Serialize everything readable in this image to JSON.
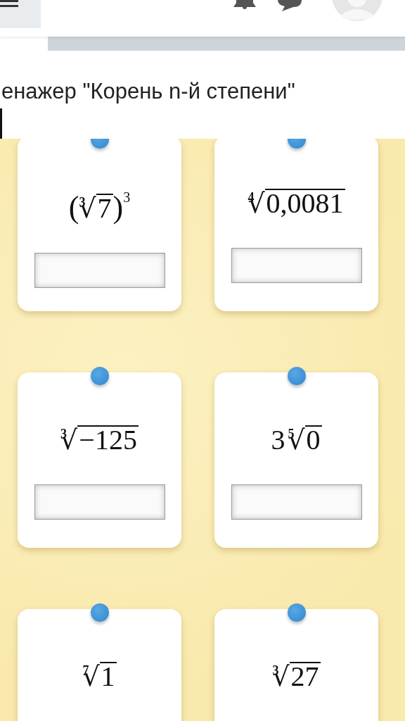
{
  "header": {
    "title": "енажер \"Корень n-й степени\""
  },
  "cards": [
    {
      "expression": {
        "open": "(",
        "index": "3",
        "sign": "√",
        "radicand": "7",
        "close": ")",
        "power": "3"
      },
      "kind": "full"
    },
    {
      "expression": {
        "index": "4",
        "sign": "√",
        "radicand": "0,0081"
      },
      "kind": "full"
    },
    {
      "expression": {
        "index": "3",
        "sign": "√",
        "radicand": "−125"
      },
      "kind": "full"
    },
    {
      "expression": {
        "prefix": "3",
        "index": "5",
        "sign": "√",
        "radicand": "0"
      },
      "kind": "full"
    },
    {
      "expression": {
        "index": "7",
        "sign": "√",
        "radicand": "1"
      },
      "kind": "cut"
    },
    {
      "expression": {
        "index": "3",
        "sign": "√",
        "radicand": "27"
      },
      "kind": "cut"
    }
  ]
}
